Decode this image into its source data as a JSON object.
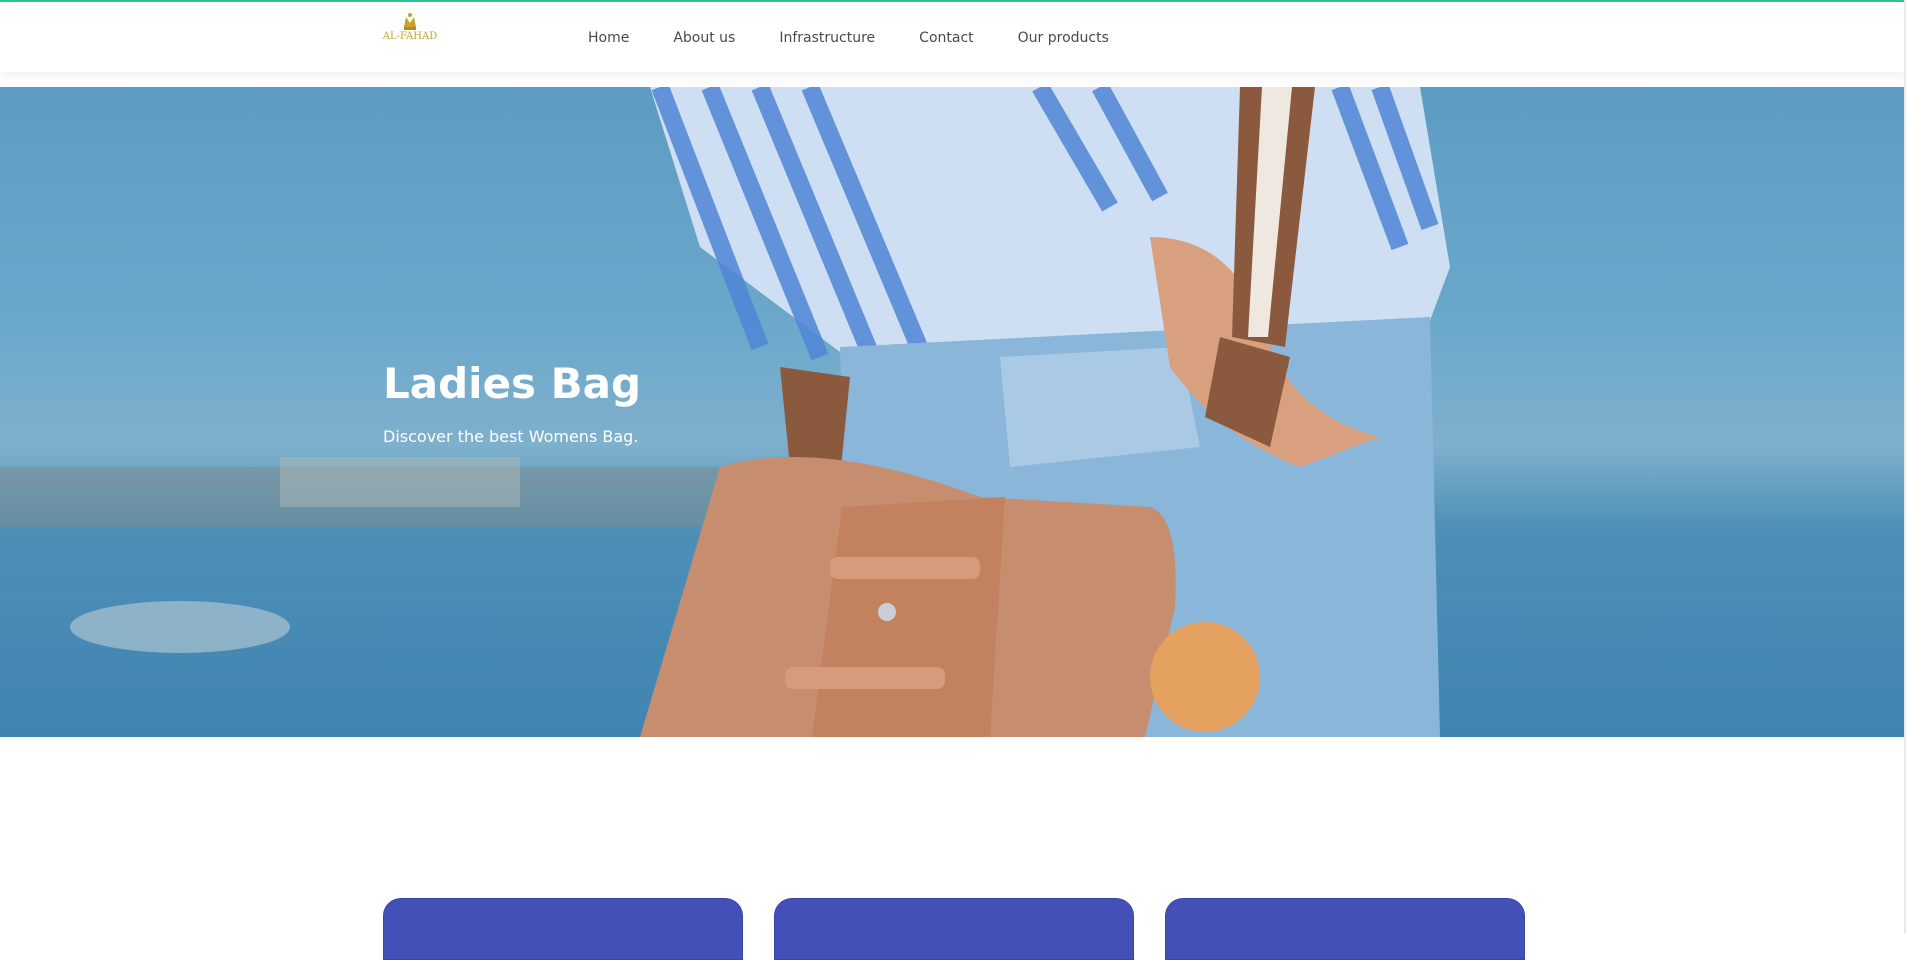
{
  "header": {
    "logo_text": "AL-FAHAD",
    "nav": [
      {
        "label": "Home"
      },
      {
        "label": "About us"
      },
      {
        "label": "Infrastructure"
      },
      {
        "label": "Contact"
      },
      {
        "label": "Our products"
      }
    ]
  },
  "hero": {
    "title": "Ladies Bag",
    "subtitle": "Discover the best Womens Bag."
  },
  "colors": {
    "accent": "#2bc59a",
    "card": "#4250b8",
    "logo": "#c9a227"
  }
}
